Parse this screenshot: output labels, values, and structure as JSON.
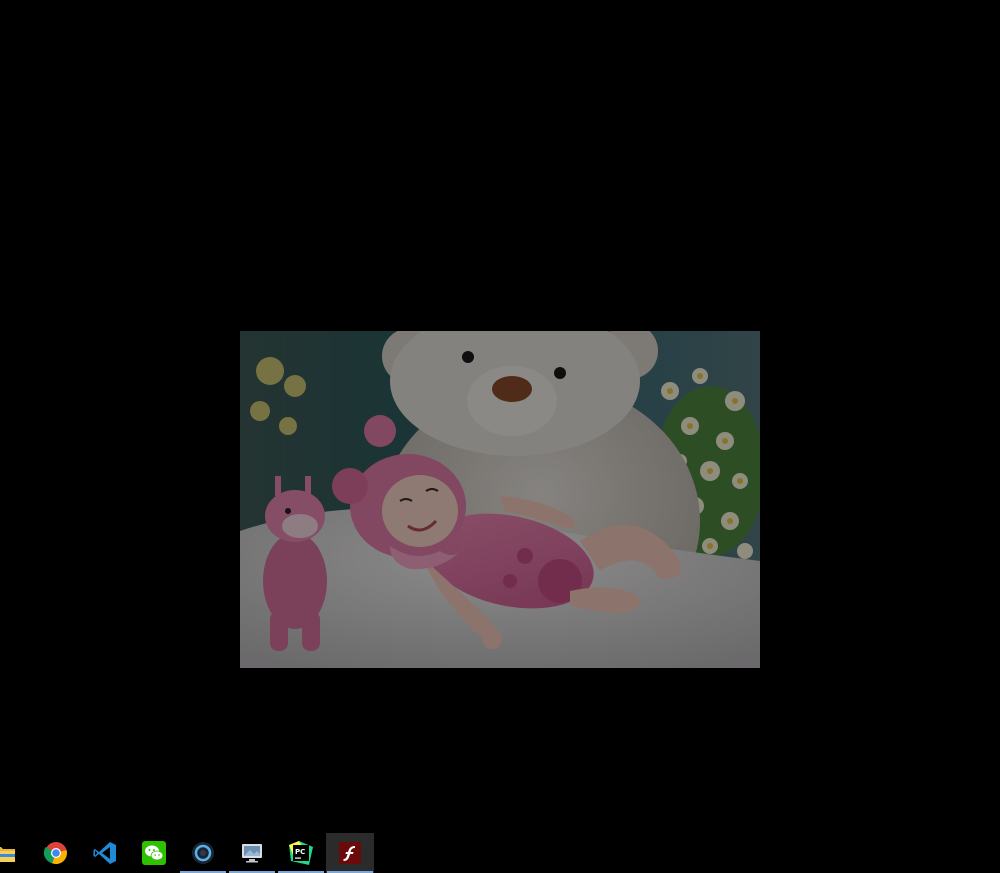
{
  "desktop": {
    "background_color": "#000000"
  },
  "photo_viewer": {
    "image_subject": "baby-in-pink-outfit-with-teddy-bear"
  },
  "taskbar": {
    "background_color": "#000000",
    "underline_color": "#7aa8d8",
    "items": [
      {
        "name": "file-explorer",
        "icon": "folder-icon",
        "running": false,
        "active": false
      },
      {
        "name": "chrome",
        "icon": "chrome-icon",
        "running": false,
        "active": false
      },
      {
        "name": "vscode",
        "icon": "vscode-icon",
        "running": false,
        "active": false
      },
      {
        "name": "wechat",
        "icon": "wechat-icon",
        "running": false,
        "active": false
      },
      {
        "name": "circle-app",
        "icon": "power-circle-icon",
        "running": true,
        "active": false
      },
      {
        "name": "remote-desktop",
        "icon": "remote-desktop-icon",
        "running": true,
        "active": false
      },
      {
        "name": "pycharm",
        "icon": "pycharm-icon",
        "running": true,
        "active": false
      },
      {
        "name": "flash-player",
        "icon": "flash-icon",
        "running": true,
        "active": true
      }
    ]
  }
}
